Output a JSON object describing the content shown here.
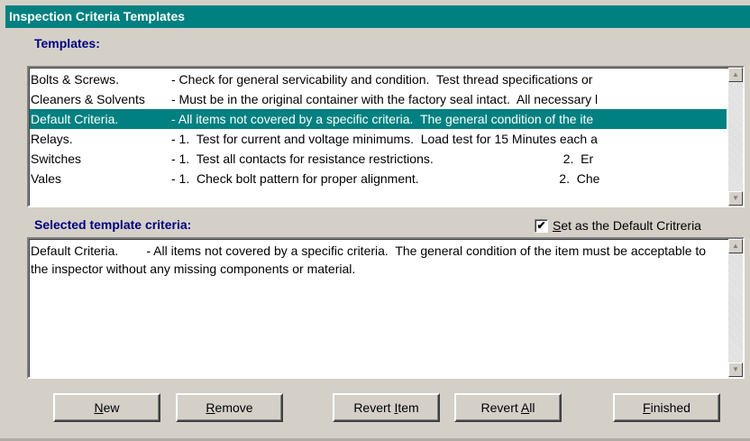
{
  "window": {
    "title": "Inspection Criteria Templates"
  },
  "templates": {
    "label": "Templates:",
    "rows": [
      {
        "name": "Bolts & Screws.",
        "desc": "- Check for general servicability and condition.  Test thread specifications or"
      },
      {
        "name": "Cleaners & Solvents",
        "desc": "- Must be in the original container with the factory seal intact.  All necessary l"
      },
      {
        "name": "Default Criteria.",
        "desc": "- All items not covered by a specific criteria.  The general condition of the ite"
      },
      {
        "name": "Relays.",
        "desc": "- 1.  Test for current and voltage minimums.  Load test for 15 Minutes each a"
      },
      {
        "name": "Switches",
        "desc": "- 1.  Test all contacts for resistance restrictions.                                     2.  Er"
      },
      {
        "name": "Vales",
        "desc": "- 1.  Check bolt pattern for proper alignment.                                        2.  Che"
      }
    ],
    "selected_index": 2
  },
  "criteria": {
    "label": "Selected template criteria:",
    "default_checkbox": {
      "label_first": "S",
      "label_rest": "et as the Default Critreria",
      "checked": true,
      "mark": "✔"
    },
    "text": "Default Criteria.        - All items not covered by a specific criteria.  The general condition of the item must be acceptable to the inspector without any missing components or material."
  },
  "buttons": {
    "new": {
      "u": "N",
      "rest": "ew"
    },
    "remove": {
      "u": "R",
      "rest": "emove"
    },
    "revert_item": {
      "pre": "Revert ",
      "u": "I",
      "rest": "tem"
    },
    "revert_all": {
      "pre": "Revert ",
      "u": "A",
      "rest": "ll"
    },
    "finished": {
      "u": "F",
      "rest": "inished"
    }
  },
  "icons": {
    "scroll_up": "▲",
    "scroll_down": "▼"
  },
  "colors": {
    "title_bar": "#008080",
    "selection": "#008080",
    "section_label": "#000080",
    "face": "#d4d0c8"
  }
}
